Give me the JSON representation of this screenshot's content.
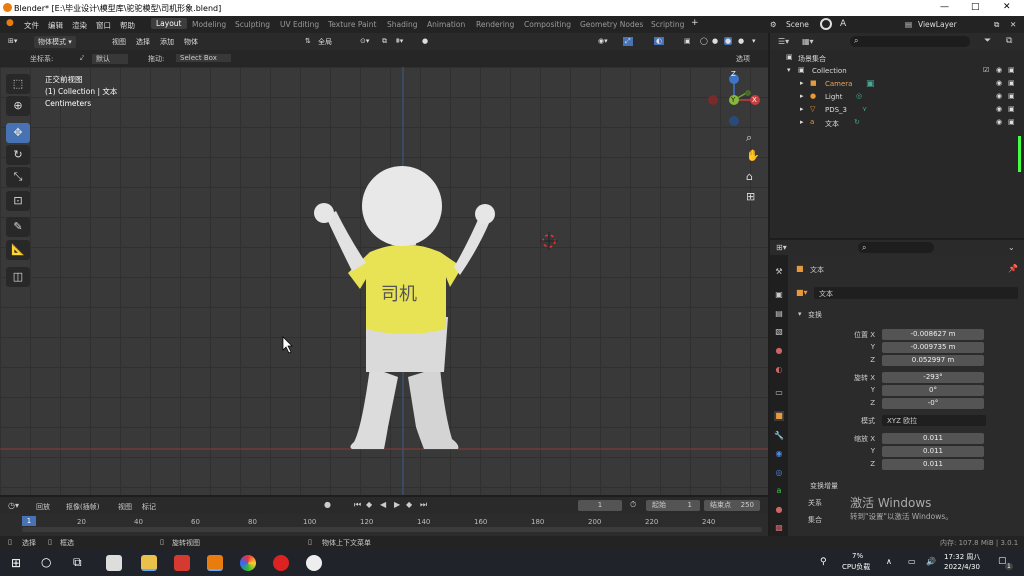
{
  "window": {
    "title": "Blender* [E:\\毕业设计\\模型库\\驼驼模型\\司机形象.blend]",
    "controls": [
      "—",
      "□",
      "✕"
    ]
  },
  "menubar": {
    "items": [
      "文件",
      "编辑",
      "渲染",
      "窗口",
      "帮助"
    ],
    "workspaces": [
      "Layout",
      "Modeling",
      "Sculpting",
      "UV Editing",
      "Texture Paint",
      "Shading",
      "Animation",
      "Rendering",
      "Compositing",
      "Geometry Nodes",
      "Scripting"
    ],
    "add_tab": "+",
    "scene_label": "Scene",
    "viewlayer_label": "ViewLayer"
  },
  "viewport_header": {
    "mode": "物体模式",
    "menus": [
      "视图",
      "选择",
      "添加",
      "物体"
    ],
    "transform_orientation": "全局",
    "snapping": "",
    "options_label": "选项"
  },
  "tool_settings": {
    "coord_label": "坐标系:",
    "coord_value": "默认",
    "drag_label": "拖动:",
    "drag_value": "Select Box"
  },
  "viewport_info": {
    "view_name": "正交前视图",
    "collection_line": "(1) Collection | 文本",
    "units": "Centimeters"
  },
  "shirt_text": "司机",
  "nav_gizmo": {
    "x": "X",
    "y": "Y",
    "z": "Z"
  },
  "outliner": {
    "title": "场景集合",
    "items": [
      {
        "name": "Collection",
        "indent": 0
      },
      {
        "name": "Camera",
        "indent": 1
      },
      {
        "name": "Light",
        "indent": 1
      },
      {
        "name": "PDS_3",
        "indent": 1
      },
      {
        "name": "文本",
        "indent": 1
      }
    ]
  },
  "properties": {
    "object_name": "文本",
    "data_name": "文本",
    "section_transform": "变换",
    "location_label": "位置 X",
    "loc": [
      "-0.008627 m",
      "-0.009735 m",
      "0.052997 m"
    ],
    "rotation_label": "旋转 X",
    "rot": [
      "-293°",
      "0°",
      "-0°"
    ],
    "mode_label": "模式",
    "mode_value": "XYZ 欧拉",
    "scale_label": "缩放 X",
    "scale": [
      "0.011",
      "0.011",
      "0.011"
    ],
    "axis_y": "Y",
    "axis_z": "Z",
    "delta_label": "变换增量",
    "relations_label": "关系",
    "collections_label": "集合",
    "watermark_title": "激活 Windows",
    "watermark_sub": "转到\"设置\"以激活 Windows。"
  },
  "timeline": {
    "menus": [
      "回放",
      "抠像(插帧)",
      "视图",
      "标记"
    ],
    "current_frame": "1",
    "start_label": "起始",
    "start": "1",
    "end_label": "结束点",
    "end": "250",
    "ticks": [
      "0",
      "20",
      "40",
      "60",
      "80",
      "100",
      "120",
      "140",
      "160",
      "180",
      "200",
      "220",
      "240"
    ]
  },
  "statusbar": {
    "left": [
      "选择",
      "框选",
      "旋转视图",
      "物体上下文菜单"
    ],
    "right": "内存: 107.8 MiB | 3.0.1"
  },
  "taskbar": {
    "cpu": "7%",
    "cpu_label": "CPU负载",
    "time": "17:32 周八",
    "date": "2022/4/30",
    "notif": "1"
  }
}
